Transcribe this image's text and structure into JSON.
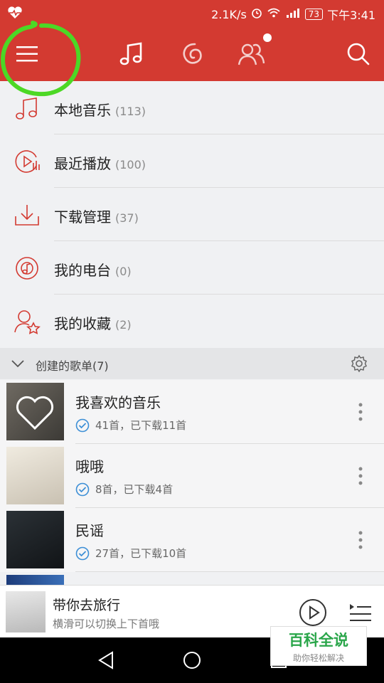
{
  "status_bar": {
    "speed": "2.1K/s",
    "battery": "73",
    "time": "下午3:41"
  },
  "menu_items": [
    {
      "label": "本地音乐",
      "count": "(113)",
      "icon": "music-note-icon"
    },
    {
      "label": "最近播放",
      "count": "(100)",
      "icon": "recent-play-icon"
    },
    {
      "label": "下载管理",
      "count": "(37)",
      "icon": "download-icon"
    },
    {
      "label": "我的电台",
      "count": "(0)",
      "icon": "radio-icon"
    },
    {
      "label": "我的收藏",
      "count": "(2)",
      "icon": "favorite-user-star-icon"
    }
  ],
  "playlists_section": {
    "title": "创建的歌单(7)"
  },
  "playlists": [
    {
      "name": "我喜欢的音乐",
      "meta": "41首，已下载11首"
    },
    {
      "name": "哦哦",
      "meta": "8首，已下载4首"
    },
    {
      "name": "民谣",
      "meta": "27首，已下载10首"
    }
  ],
  "mini_player": {
    "title": "带你去旅行",
    "subtitle": "横滑可以切换上下首哦"
  },
  "watermark": {
    "title": "百科全说",
    "subtitle": "助你轻松解决"
  },
  "colors": {
    "brand_red": "#d33a31",
    "annotation_green": "#4cd825",
    "check_blue": "#3d8fd6"
  }
}
